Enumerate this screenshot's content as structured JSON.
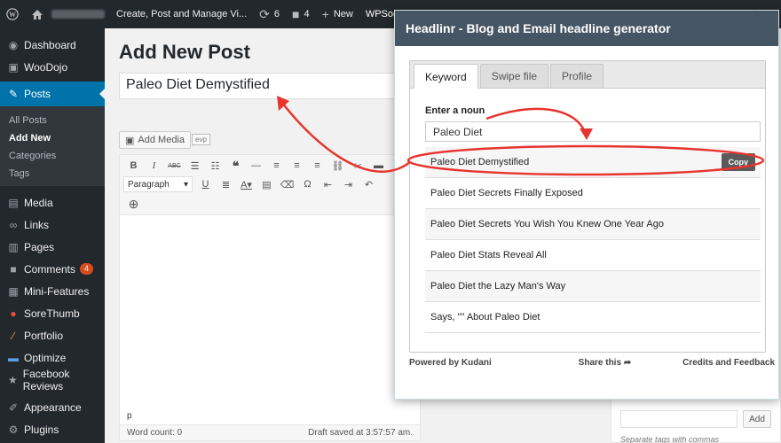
{
  "adminbar": {
    "site_title": "Create, Post and Manage Vi...",
    "updates_count": "6",
    "comments_count": "4",
    "new_label": "New",
    "wpsocial_label": "WPSocial"
  },
  "sidebar": {
    "items": [
      {
        "label": "Dashboard",
        "icon": "dashboard-icon"
      },
      {
        "label": "WooDojo",
        "icon": "dojo-icon"
      },
      {
        "label": "Posts",
        "icon": "pin-icon"
      },
      {
        "label": "Media",
        "icon": "media-icon"
      },
      {
        "label": "Links",
        "icon": "link-icon"
      },
      {
        "label": "Pages",
        "icon": "pages-icon"
      },
      {
        "label": "Comments",
        "icon": "comment-icon",
        "badge": "4"
      },
      {
        "label": "Mini-Features",
        "icon": "box-icon"
      },
      {
        "label": "SoreThumb",
        "icon": "thumb-icon"
      },
      {
        "label": "Portfolio",
        "icon": "brush-icon"
      },
      {
        "label": "Optimize",
        "icon": "optimize-icon"
      },
      {
        "label": "Facebook Reviews",
        "icon": "star-icon"
      },
      {
        "label": "Appearance",
        "icon": "appearance-icon"
      },
      {
        "label": "Plugins",
        "icon": "plugin-icon"
      }
    ],
    "posts_submenu": [
      "All Posts",
      "Add New",
      "Categories",
      "Tags"
    ]
  },
  "editor": {
    "page_title": "Add New Post",
    "post_title": "Paleo Diet Demystified",
    "add_media_label": "Add Media",
    "evp_label": "evp",
    "format_select": "Paragraph",
    "path": "p",
    "word_count": "Word count: 0",
    "draft_saved": "Draft saved at 3:57:57 am."
  },
  "tags_box": {
    "add_label": "Add",
    "hint": "Separate tags with commas"
  },
  "popup": {
    "title": "Headlinr - Blog and Email headline generator",
    "tabs": [
      "Keyword",
      "Swipe file",
      "Profile"
    ],
    "noun_label": "Enter a noun",
    "noun_value": "Paleo Diet",
    "copy_label": "Copy",
    "results": [
      "Paleo Diet Demystified",
      "Paleo Diet Secrets Finally Exposed",
      "Paleo Diet Secrets You Wish You Knew One Year Ago",
      "Paleo Diet Stats Reveal All",
      "Paleo Diet the Lazy Man's Way",
      "Says, \"\" About Paleo Diet"
    ],
    "footer": {
      "powered": "Powered by Kudani",
      "share": "Share this",
      "credits": "Credits and Feedback"
    }
  },
  "colors": {
    "sidebar_bg": "#23282d",
    "active_blue": "#0073aa",
    "popup_header": "#465563",
    "annotation_red": "#e8342e"
  }
}
